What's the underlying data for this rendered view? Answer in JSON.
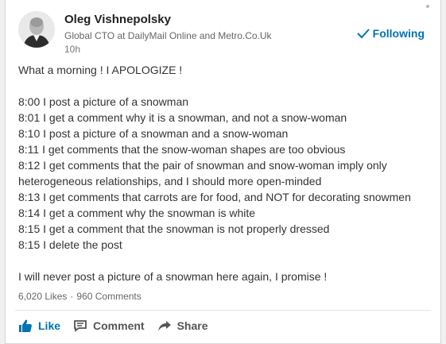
{
  "post": {
    "author_name": "Oleg Vishnepolsky",
    "author_headline": "Global CTO at DailyMail Online and Metro.Co.Uk",
    "time": "10h",
    "follow_label": "Following",
    "lines": [
      "What a morning ! I APOLOGIZE !",
      "",
      "8:00 I post a picture of a snowman",
      "8:01 I get a comment why it is a snowman, and not a snow-woman",
      "8:10 I post a picture of a snowman and a snow-woman",
      "8:11 I get comments that the snow-woman shapes are too obvious",
      "8:12 I get comments that the pair of snowman and snow-woman imply only",
      "heterogeneous relationships, and I should more open-minded",
      "8:13 I get comments that carrots are for food, and NOT for decorating snowmen",
      "8:14 I get a comment why the snowman is white",
      "8:15 I get a comment that the snowman is not properly dressed",
      "8:15 I delete the post",
      "",
      "I will never post a picture of a snowman here again, I promise !"
    ]
  },
  "social": {
    "likes": "6,020 Likes",
    "separator": "·",
    "comments": "960 Comments"
  },
  "actions": {
    "like_label": "Like",
    "comment_label": "Comment",
    "share_label": "Share"
  },
  "colors": {
    "accent": "#0073b1"
  }
}
